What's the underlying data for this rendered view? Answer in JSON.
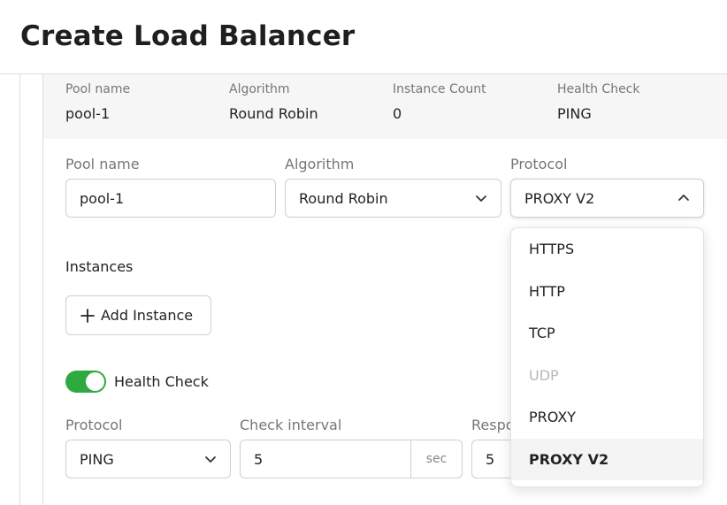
{
  "page": {
    "title": "Create Load Balancer"
  },
  "summary": {
    "pool_name_label": "Pool name",
    "pool_name_value": "pool-1",
    "algorithm_label": "Algorithm",
    "algorithm_value": "Round Robin",
    "instance_count_label": "Instance Count",
    "instance_count_value": "0",
    "health_check_label": "Health Check",
    "health_check_value": "PING"
  },
  "form": {
    "pool_name_label": "Pool name",
    "pool_name_value": "pool-1",
    "algorithm_label": "Algorithm",
    "algorithm_value": "Round Robin",
    "protocol_label": "Protocol",
    "protocol_value": "PROXY V2"
  },
  "instances": {
    "title": "Instances",
    "add_button": "Add Instance"
  },
  "health_check": {
    "toggle_label": "Health Check",
    "enabled": true,
    "protocol_label": "Protocol",
    "protocol_value": "PING",
    "interval_label": "Check interval",
    "interval_value": "5",
    "interval_unit": "sec",
    "response_label": "Respo",
    "response_value": "5"
  },
  "protocol_dropdown": {
    "options": [
      {
        "label": "HTTPS",
        "disabled": false,
        "selected": false
      },
      {
        "label": "HTTP",
        "disabled": false,
        "selected": false
      },
      {
        "label": "TCP",
        "disabled": false,
        "selected": false
      },
      {
        "label": "UDP",
        "disabled": true,
        "selected": false
      },
      {
        "label": "PROXY",
        "disabled": false,
        "selected": false
      },
      {
        "label": "PROXY V2",
        "disabled": false,
        "selected": true
      }
    ]
  },
  "colors": {
    "toggle_on": "#2eaa3f",
    "summary_bg": "#f6f6f6",
    "disabled_text": "#b8b8b8"
  }
}
